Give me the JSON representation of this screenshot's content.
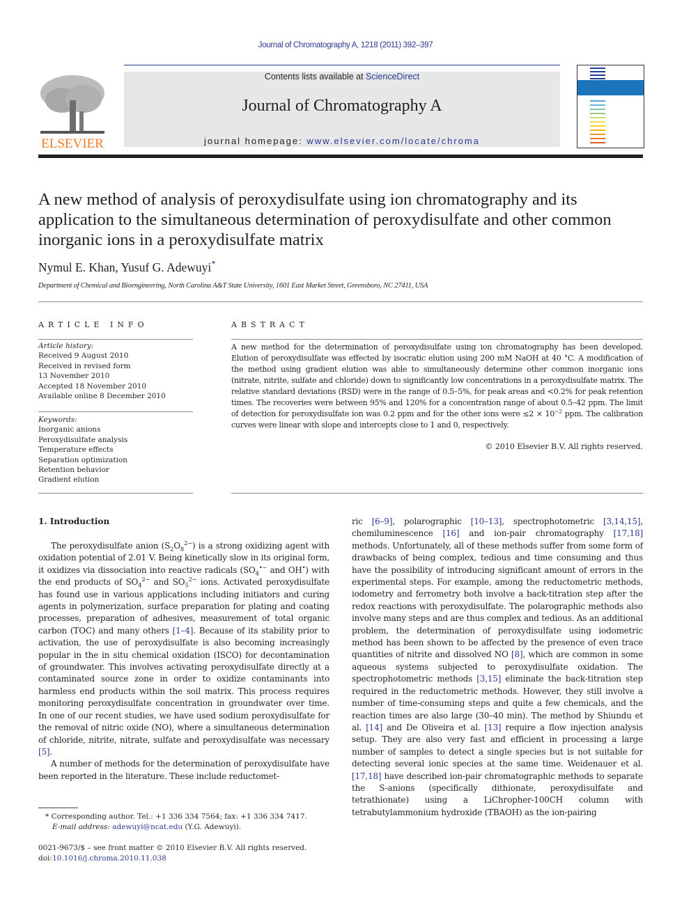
{
  "header": {
    "running_head": "Journal of Chromatography A, 1218 (2011) 392–397",
    "contents_prefix": "Contents lists available at ",
    "contents_link": "ScienceDirect",
    "journal_title": "Journal of Chromatography A",
    "homepage_prefix": "journal homepage: ",
    "homepage_link": "www.elsevier.com/locate/chroma",
    "publisher_logo": "ELSEVIER",
    "cover_alt": "Journal of Chromatography A cover",
    "colors": {
      "link": "#2b3990",
      "publisher": "#f47920",
      "banner": "#e6e7e8"
    }
  },
  "article": {
    "title": "A new method of analysis of peroxydisulfate using ion chromatography and its application to the simultaneous determination of peroxydisulfate and other common inorganic ions in a peroxydisulfate matrix",
    "authors": "Nymul E. Khan, Yusuf G. Adewuyi",
    "author_mark": "*",
    "affiliation": "Department of Chemical and Bioengineering, North Carolina A&T State University, 1601 East Market Street, Greensboro, NC 27411, USA"
  },
  "article_info": {
    "heading": "ARTICLE INFO",
    "history_label": "Article history:",
    "history": [
      "Received 9 August 2010",
      "Received in revised form",
      "13 November 2010",
      "Accepted 18 November 2010",
      "Available online 8 December 2010"
    ],
    "keywords_label": "Keywords:",
    "keywords": [
      "Inorganic anions",
      "Peroxydisulfate analysis",
      "Temperature effects",
      "Separation optimization",
      "Retention behavior",
      "Gradient elution"
    ]
  },
  "abstract": {
    "heading": "ABSTRACT",
    "text_1": "A new method for the determination of peroxydisulfate using ion chromatography has been developed. Elution of peroxydisulfate was effected by isocratic elution using 200 mM NaOH at 40 °C. A modification of the method using gradient elution was able to simultaneously determine other common inorganic ions (nitrate, nitrite, sulfate and chloride) down to significantly low concentrations in a peroxydisulfate matrix. The relative standard deviations (RSD) were in the range of 0.5–5%, for peak areas and <0.2% for peak retention times. The recoveries were between 95% and 120% for a concentration range of about 0.5–42 ppm. The limit of detection for peroxydisulfate ion was 0.2 ppm and for the other ions were ≤2 × 10",
    "exp": "−2",
    "text_2": " ppm. The calibration curves were linear with slope and intercepts close to 1 and 0, respectively.",
    "copyright": "© 2010 Elsevier B.V. All rights reserved."
  },
  "intro": {
    "heading": "1.  Introduction",
    "p1": {
      "a": "The peroxydisulfate anion (S",
      "a_sub1": "2",
      "a2": "O",
      "a_sub2": "8",
      "a_sup": "2−",
      "b": ") is a strong oxidizing agent with oxidation potential of 2.01 V. Being kinetically slow in its original form, it oxidizes via dissociation into reactive radicals (SO",
      "b_sub": "4",
      "b_sup": "•−",
      "c": " and OH",
      "c_sup": "•",
      "d": ") with the end products of SO",
      "d_sub": "4",
      "d_sup": "2−",
      "e": " and SO",
      "e_sub": "5",
      "e_sup": "2−",
      "f": " ions. Activated peroxydisulfate has found use in various applications including initiators and curing agents in polymerization, surface preparation for plating and coating processes, preparation of adhesives, measurement of total organic carbon (TOC) and many others ",
      "ref1": "[1–4]",
      "g": ". Because of its stability prior to activation, the use of peroxydisulfate is also becoming increasingly popular in the in situ chemical oxidation (ISCO) for decontamination of groundwater. This involves activating peroxydisulfate directly at a contaminated source zone in order to oxidize contaminants into harmless end products within the soil matrix. This process requires monitoring peroxydisulfate concentration in groundwater over time. In one of our recent studies, we have used sodium peroxydisulfate for the removal of nitric oxide (NO), where a simultaneous determination of chloride, nitrite, nitrate, sulfate and peroxydisulfate was necessary ",
      "ref2": "[5]",
      "h": "."
    },
    "p2_col1": "A number of methods for the determination of peroxydisulfate have been reported in the literature. These include reductomet-",
    "p2_col2": {
      "a": "ric ",
      "r1": "[6–9]",
      "b": ", polarographic ",
      "r2": "[10–13]",
      "c": ", spectrophotometric ",
      "r3": "[3,14,15]",
      "d": ", chemiluminescence ",
      "r4": "[16]",
      "e": " and ion-pair chromatography ",
      "r5": "[17,18]",
      "f": " methods. Unfortunately, all of these methods suffer from some form of drawbacks of being complex, tedious and time consuming and thus have the possibility of introducing significant amount of errors in the experimental steps. For example, among the reductometric methods, iodometry and ferrometry both involve a back-titration step after the redox reactions with peroxydisulfate. The polarographic methods also involve many steps and are thus complex and tedious. As an additional problem, the determination of peroxydisulfate using iodometric method has been shown to be affected by the presence of even trace quantities of nitrite and dissolved NO ",
      "r6": "[8]",
      "g": ", which are common in some aqueous systems subjected to peroxydisulfate oxidation. The spectrophotometric methods ",
      "r7": "[3,15]",
      "h": " eliminate the back-titration step required in the reductometric methods. However, they still involve a number of time-consuming steps and quite a few chemicals, and the reaction times are also large (30–40 min). The method by Shiundu et al. ",
      "r8": "[14]",
      "i": " and De Oliveira et al. ",
      "r9": "[13]",
      "j": " require a flow injection analysis setup. They are also very fast and efficient in processing a large number of samples to detect a single species but is not suitable for detecting several ionic species at the same time. Weidenauer et al. ",
      "r10": "[17,18]",
      "k": " have described ion-pair chromatographic methods to separate the S-anions (specifically dithionate, peroxydisulfate and tetrathionate) using a LiChropher-100CH column with tetrabutylammonium hydroxide (TBAOH) as the ion-pairing"
    }
  },
  "footnote": {
    "mark": "*",
    "corresponding": " Corresponding author. Tel.: +1 336 334 7564; fax: +1 336 334 7417.",
    "email_label": "E-mail address: ",
    "email": "adewuyi@ncat.edu",
    "email_suffix": " (Y.G. Adewuyi).",
    "issn": "0021-9673/$ – see front matter © 2010 Elsevier B.V. All rights reserved.",
    "doi_prefix": "doi:",
    "doi": "10.1016/j.chroma.2010.11.038"
  }
}
